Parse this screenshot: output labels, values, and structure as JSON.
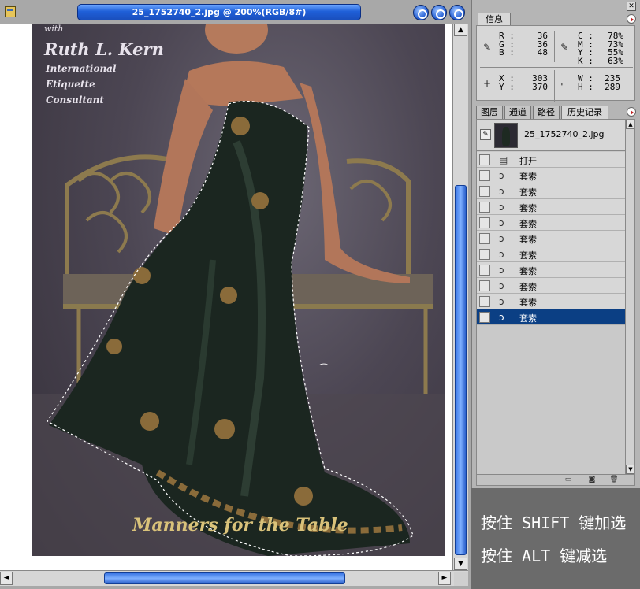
{
  "document": {
    "title": "25_1752740_2.jpg @ 200%(RGB/8#)",
    "photo": {
      "with": "with",
      "name": "Ruth L. Kern",
      "subtitle_lines": [
        "International",
        "Etiquette",
        "Consultant"
      ],
      "footer": "Manners for the Table"
    },
    "scroll_up": "▲",
    "scroll_down": "▼",
    "scroll_left": "◄",
    "scroll_right": "►"
  },
  "info_panel": {
    "tab_label": "信息",
    "rgb": {
      "labels": [
        "R :",
        "G :",
        "B :"
      ],
      "values": [
        "36",
        "36",
        "48"
      ]
    },
    "cmyk": {
      "labels": [
        "C :",
        "M :",
        "Y :",
        "K :"
      ],
      "values": [
        "78%",
        "73%",
        "55%",
        "63%"
      ]
    },
    "xy": {
      "labels": [
        "X :",
        "Y :"
      ],
      "values": [
        "303",
        "370"
      ]
    },
    "wh": {
      "labels": [
        "W :",
        "H :"
      ],
      "values": [
        "235",
        "289"
      ]
    }
  },
  "history_panel": {
    "tabs": [
      "图层",
      "通道",
      "路径",
      "历史记录"
    ],
    "active_tab": "历史记录",
    "snapshot_name": "25_1752740_2.jpg",
    "steps": [
      {
        "label": "打开",
        "icon": "document-icon"
      },
      {
        "label": "套索",
        "icon": "lasso-icon"
      },
      {
        "label": "套索",
        "icon": "lasso-icon"
      },
      {
        "label": "套索",
        "icon": "lasso-icon"
      },
      {
        "label": "套索",
        "icon": "lasso-icon"
      },
      {
        "label": "套索",
        "icon": "lasso-icon"
      },
      {
        "label": "套索",
        "icon": "lasso-icon"
      },
      {
        "label": "套索",
        "icon": "lasso-icon"
      },
      {
        "label": "套索",
        "icon": "lasso-icon"
      },
      {
        "label": "套索",
        "icon": "lasso-icon"
      },
      {
        "label": "套索",
        "icon": "lasso-icon",
        "selected": true
      }
    ]
  },
  "caption": {
    "line1": "按住 SHIFT 键加选",
    "line2": "按住 ALT 键减选"
  },
  "colors": {
    "title_blue": "#1f5fd8",
    "selected_row": "#0b3f84",
    "panel_gray": "#b5b5b5"
  }
}
